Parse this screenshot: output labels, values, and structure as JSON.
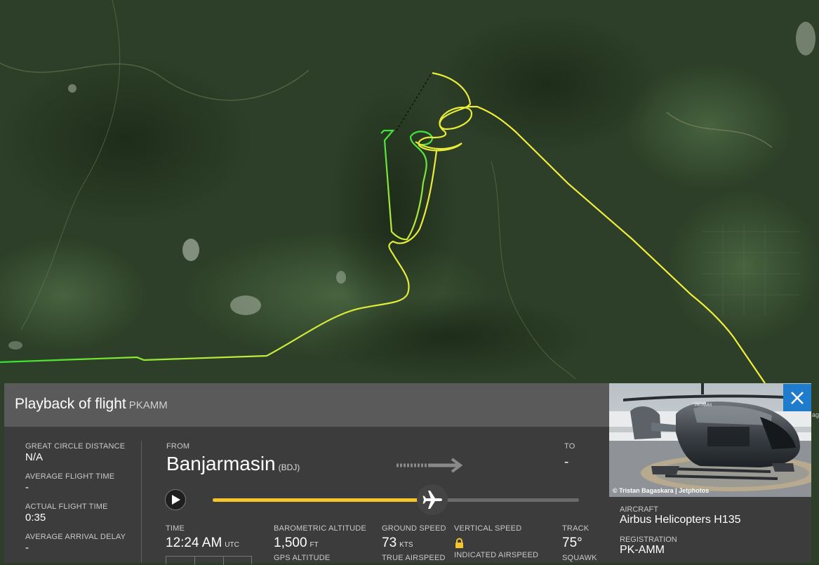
{
  "panel": {
    "title": "Playback of flight",
    "registration_code": "PKAMM",
    "close_icon": "close-icon"
  },
  "stats": [
    {
      "label": "GREAT CIRCLE DISTANCE",
      "value": "N/A"
    },
    {
      "label": "AVERAGE FLIGHT TIME",
      "value": "-"
    },
    {
      "label": "ACTUAL FLIGHT TIME",
      "value": "0:35"
    },
    {
      "label": "AVERAGE ARRIVAL DELAY",
      "value": "-"
    }
  ],
  "route": {
    "from_label": "FROM",
    "from_city": "Banjarmasin",
    "from_code": "(BDJ)",
    "to_label": "TO",
    "to_city": "-"
  },
  "playback": {
    "progress": 0.6,
    "play_icon": "play-icon",
    "plane_icon": "airplane-icon"
  },
  "readouts": {
    "time_label": "TIME",
    "time_value": "12:24 AM",
    "time_unit": "UTC",
    "baro_label": "BAROMETRIC ALTITUDE",
    "baro_value": "1,500",
    "baro_unit": "FT",
    "gps_label": "GPS ALTITUDE",
    "gs_label": "GROUND SPEED",
    "gs_value": "73",
    "gs_unit": "KTS",
    "tas_label": "TRUE AIRSPEED",
    "vs_label": "VERTICAL SPEED",
    "ias_label": "INDICATED AIRSPEED",
    "track_label": "TRACK",
    "track_value": "75°",
    "squawk_label": "SQUAWK"
  },
  "aircraft": {
    "photo_credit": "© Tristan Bagaskara | Jetphotos",
    "photo_reg_text": "PK-AMM",
    "aircraft_label": "AIRCRAFT",
    "aircraft_value": "Airbus Helicopters H135",
    "registration_label": "REGISTRATION",
    "registration_value": "PK-AMM"
  },
  "map": {
    "edge_text": "age",
    "track_colors": [
      "#3ee63e",
      "#9ee83a",
      "#e6ec3a",
      "#f4ef3c"
    ]
  }
}
